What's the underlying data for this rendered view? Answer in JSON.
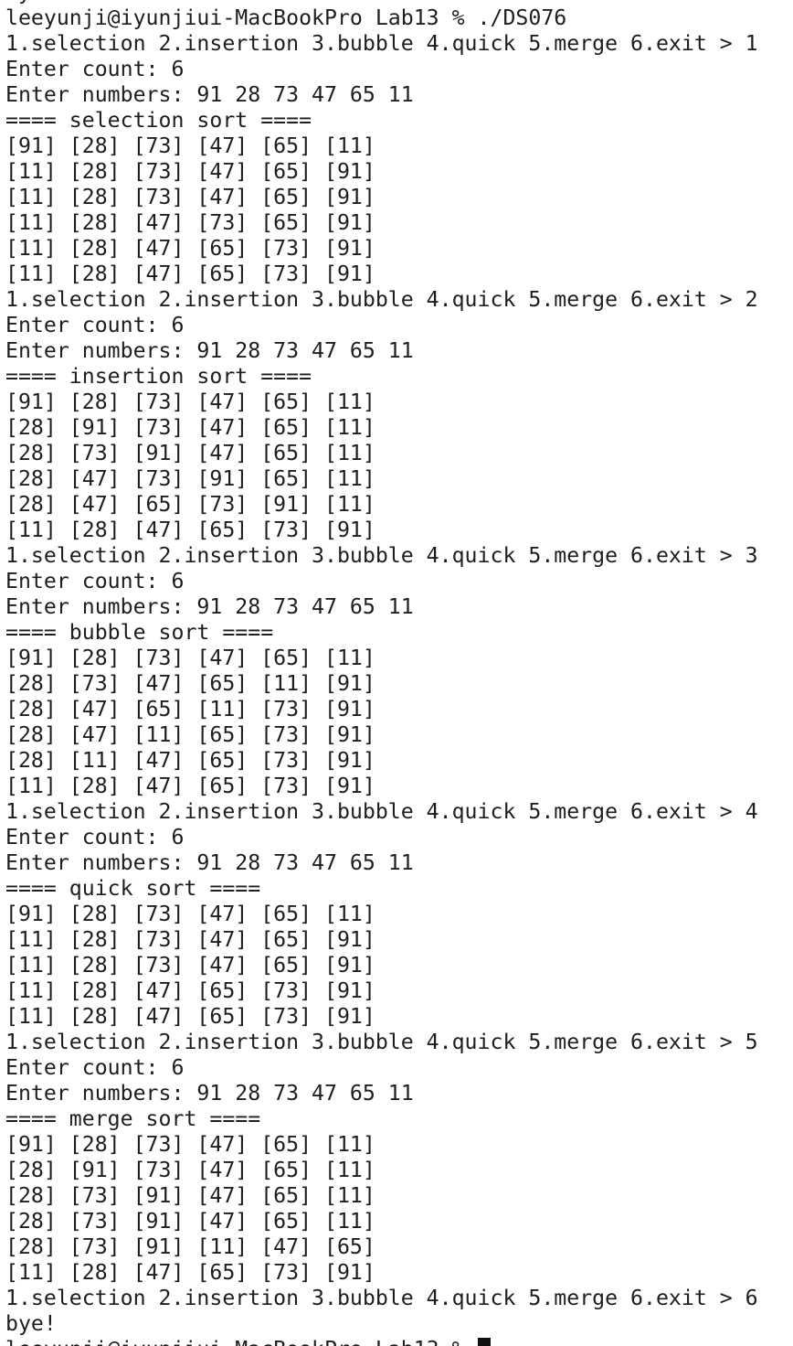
{
  "terminal": {
    "lines": [
      "bye!",
      "leeyunji@iyunjiui-MacBookPro Lab13 % ./DS076",
      "1.selection 2.insertion 3.bubble 4.quick 5.merge 6.exit > 1",
      "Enter count: 6",
      "Enter numbers: 91 28 73 47 65 11",
      "==== selection sort ====",
      "[91] [28] [73] [47] [65] [11]",
      "[11] [28] [73] [47] [65] [91]",
      "[11] [28] [73] [47] [65] [91]",
      "[11] [28] [47] [73] [65] [91]",
      "[11] [28] [47] [65] [73] [91]",
      "[11] [28] [47] [65] [73] [91]",
      "1.selection 2.insertion 3.bubble 4.quick 5.merge 6.exit > 2",
      "Enter count: 6",
      "Enter numbers: 91 28 73 47 65 11",
      "==== insertion sort ====",
      "[91] [28] [73] [47] [65] [11]",
      "[28] [91] [73] [47] [65] [11]",
      "[28] [73] [91] [47] [65] [11]",
      "[28] [47] [73] [91] [65] [11]",
      "[28] [47] [65] [73] [91] [11]",
      "[11] [28] [47] [65] [73] [91]",
      "1.selection 2.insertion 3.bubble 4.quick 5.merge 6.exit > 3",
      "Enter count: 6",
      "Enter numbers: 91 28 73 47 65 11",
      "==== bubble sort ====",
      "[91] [28] [73] [47] [65] [11]",
      "[28] [73] [47] [65] [11] [91]",
      "[28] [47] [65] [11] [73] [91]",
      "[28] [47] [11] [65] [73] [91]",
      "[28] [11] [47] [65] [73] [91]",
      "[11] [28] [47] [65] [73] [91]",
      "1.selection 2.insertion 3.bubble 4.quick 5.merge 6.exit > 4",
      "Enter count: 6",
      "Enter numbers: 91 28 73 47 65 11",
      "==== quick sort ====",
      "[91] [28] [73] [47] [65] [11]",
      "[11] [28] [73] [47] [65] [91]",
      "[11] [28] [73] [47] [65] [91]",
      "[11] [28] [47] [65] [73] [91]",
      "[11] [28] [47] [65] [73] [91]",
      "1.selection 2.insertion 3.bubble 4.quick 5.merge 6.exit > 5",
      "Enter count: 6",
      "Enter numbers: 91 28 73 47 65 11",
      "==== merge sort ====",
      "[91] [28] [73] [47] [65] [11]",
      "[28] [91] [73] [47] [65] [11]",
      "[28] [73] [91] [47] [65] [11]",
      "[28] [73] [91] [47] [65] [11]",
      "[28] [73] [91] [11] [47] [65]",
      "[11] [28] [47] [65] [73] [91]",
      "1.selection 2.insertion 3.bubble 4.quick 5.merge 6.exit > 6",
      "bye!"
    ],
    "prompt": "leeyunji@iyunjiui-MacBookPro Lab13 % "
  }
}
